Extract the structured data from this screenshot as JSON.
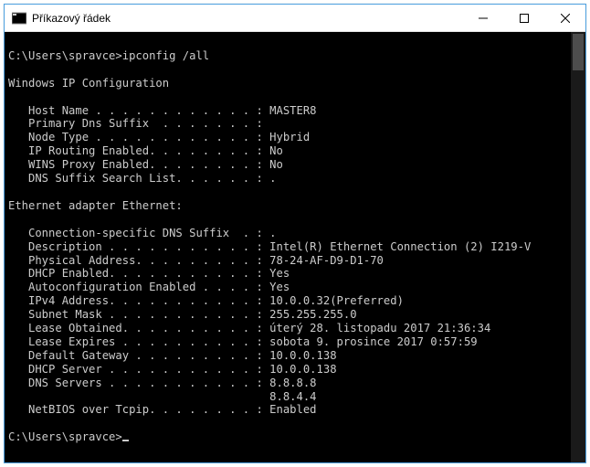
{
  "window": {
    "title": "Příkazový řádek"
  },
  "prompt": {
    "path": "C:\\Users\\spravce>",
    "command": "ipconfig /all"
  },
  "sections": {
    "ipconfig_header": "Windows IP Configuration",
    "global": [
      {
        "label": "Host Name . . . . . . . . . . . . :",
        "value": "MASTER8"
      },
      {
        "label": "Primary Dns Suffix  . . . . . . . :",
        "value": ""
      },
      {
        "label": "Node Type . . . . . . . . . . . . :",
        "value": "Hybrid"
      },
      {
        "label": "IP Routing Enabled. . . . . . . . :",
        "value": "No"
      },
      {
        "label": "WINS Proxy Enabled. . . . . . . . :",
        "value": "No"
      },
      {
        "label": "DNS Suffix Search List. . . . . . :",
        "value": "."
      }
    ],
    "adapter_header": "Ethernet adapter Ethernet:",
    "adapter": [
      {
        "label": "Connection-specific DNS Suffix  . :",
        "value": "."
      },
      {
        "label": "Description . . . . . . . . . . . :",
        "value": "Intel(R) Ethernet Connection (2) I219-V"
      },
      {
        "label": "Physical Address. . . . . . . . . :",
        "value": "78-24-AF-D9-D1-70"
      },
      {
        "label": "DHCP Enabled. . . . . . . . . . . :",
        "value": "Yes"
      },
      {
        "label": "Autoconfiguration Enabled . . . . :",
        "value": "Yes"
      },
      {
        "label": "IPv4 Address. . . . . . . . . . . :",
        "value": "10.0.0.32(Preferred)"
      },
      {
        "label": "Subnet Mask . . . . . . . . . . . :",
        "value": "255.255.255.0"
      },
      {
        "label": "Lease Obtained. . . . . . . . . . :",
        "value": "úterý 28. listopadu 2017 21:36:34"
      },
      {
        "label": "Lease Expires . . . . . . . . . . :",
        "value": "sobota 9. prosince 2017 0:57:59"
      },
      {
        "label": "Default Gateway . . . . . . . . . :",
        "value": "10.0.0.138"
      },
      {
        "label": "DHCP Server . . . . . . . . . . . :",
        "value": "10.0.0.138"
      },
      {
        "label": "DNS Servers . . . . . . . . . . . :",
        "value": "8.8.8.8"
      },
      {
        "label": "                                   ",
        "value": "8.8.4.4"
      },
      {
        "label": "NetBIOS over Tcpip. . . . . . . . :",
        "value": "Enabled"
      }
    ]
  }
}
